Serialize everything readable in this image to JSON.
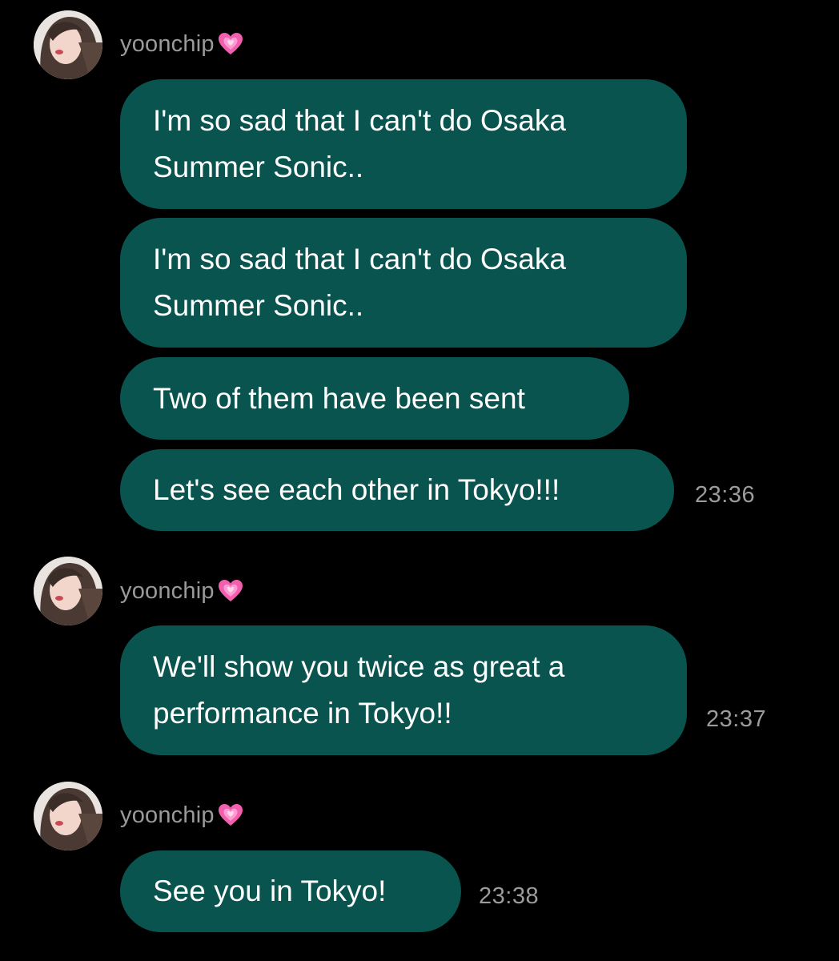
{
  "sender_name": "yoonchip",
  "sender_icon": "growing-heart-emoji",
  "accent_bubble_color": "#0a5450",
  "messages": [
    {
      "text": "I'm so sad that I can't do Osaka\nSummer Sonic.."
    },
    {
      "text": "I'm so sad that I can't do Osaka\nSummer Sonic.."
    },
    {
      "text": "Two of them have been sent"
    },
    {
      "text": "Let's see each other in Tokyo!!!",
      "time": "23:36"
    },
    {
      "text": "We'll show you twice as great a\nperformance in Tokyo!!",
      "time": "23:37"
    },
    {
      "text": "See you in Tokyo!",
      "time": "23:38"
    }
  ]
}
